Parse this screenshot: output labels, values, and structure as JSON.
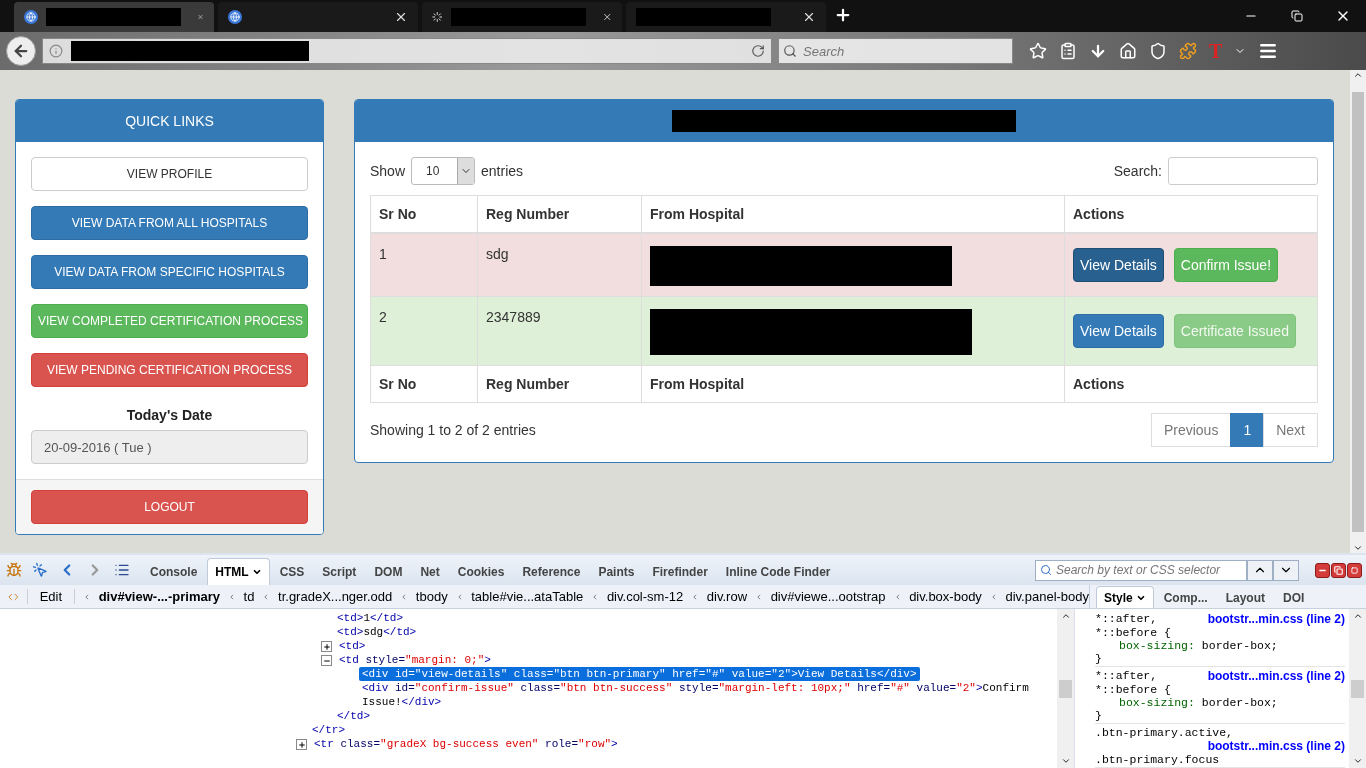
{
  "browser": {
    "tabs": [
      {
        "kind": "page",
        "selected": true
      },
      {
        "kind": "page",
        "selected": false
      },
      {
        "kind": "loading",
        "selected": false
      },
      {
        "kind": "blank",
        "selected": false
      }
    ],
    "search": {
      "placeholder": "Search"
    },
    "extension_label": "T"
  },
  "sidebar": {
    "title": "QUICK LINKS",
    "links": [
      {
        "label": "VIEW PROFILE",
        "kind": "default"
      },
      {
        "label": "VIEW DATA FROM ALL HOSPITALS",
        "kind": "primary"
      },
      {
        "label": "VIEW DATA FROM SPECIFIC HOSPITALS",
        "kind": "primary"
      },
      {
        "label": "VIEW COMPLETED CERTIFICATION PROCESS",
        "kind": "success"
      },
      {
        "label": "VIEW PENDING CERTIFICATION PROCESS",
        "kind": "danger"
      }
    ],
    "date_label": "Today's Date",
    "date_value": "20-09-2016 ( Tue )",
    "logout": "LOGOUT"
  },
  "panel": {
    "length": {
      "before": "Show",
      "value": "10",
      "after": "entries"
    },
    "search_label": "Search:",
    "table": {
      "columns": [
        "Sr No",
        "Reg Number",
        "From Hospital",
        "Actions"
      ],
      "rows": [
        {
          "color": "#f2dede",
          "sr_no": "1",
          "reg_number": "sdg",
          "actions": [
            {
              "label": "View Details",
              "kind": "primary",
              "active": true,
              "disabled": false
            },
            {
              "label": "Confirm Issue!",
              "kind": "success",
              "active": false,
              "disabled": false
            }
          ]
        },
        {
          "color": "#dff0d8",
          "sr_no": "2",
          "reg_number": "2347889",
          "actions": [
            {
              "label": "View Details",
              "kind": "primary",
              "active": false,
              "disabled": false
            },
            {
              "label": "Certificate Issued",
              "kind": "success",
              "active": false,
              "disabled": true
            }
          ]
        }
      ],
      "footer_columns": [
        "Sr No",
        "Reg Number",
        "From Hospital",
        "Actions"
      ]
    },
    "info": "Showing 1 to 2 of 2 entries",
    "pagination": [
      {
        "label": "Previous",
        "selected": false
      },
      {
        "label": "1",
        "selected": true
      },
      {
        "label": "Next",
        "selected": false
      }
    ]
  },
  "devtools": {
    "tabs": [
      {
        "label": "Console",
        "selected": false,
        "dropdown": false
      },
      {
        "label": "HTML",
        "selected": true,
        "dropdown": true
      },
      {
        "label": "CSS",
        "selected": false,
        "dropdown": false
      },
      {
        "label": "Script",
        "selected": false,
        "dropdown": false
      },
      {
        "label": "DOM",
        "selected": false,
        "dropdown": false
      },
      {
        "label": "Net",
        "selected": false,
        "dropdown": false
      },
      {
        "label": "Cookies",
        "selected": false,
        "dropdown": false
      },
      {
        "label": "Reference",
        "selected": false,
        "dropdown": false
      },
      {
        "label": "Paints",
        "selected": false,
        "dropdown": false
      },
      {
        "label": "Firefinder",
        "selected": false,
        "dropdown": false
      },
      {
        "label": "Inline Code Finder",
        "selected": false,
        "dropdown": false
      }
    ],
    "search": {
      "placeholder": "Search by text or CSS selector"
    },
    "edit": "Edit",
    "breadcrumbs": [
      {
        "label": "div#view-...-primary",
        "selected": true
      },
      {
        "label": "td",
        "selected": false
      },
      {
        "label": "tr.gradeX...nger.odd",
        "selected": false
      },
      {
        "label": "tbody",
        "selected": false
      },
      {
        "label": "table#vie...ataTable",
        "selected": false
      },
      {
        "label": "div.col-sm-12",
        "selected": false
      },
      {
        "label": "div.row",
        "selected": false
      },
      {
        "label": "div#viewe...ootstrap",
        "selected": false
      },
      {
        "label": "div.box-body",
        "selected": false
      },
      {
        "label": "div.panel-body",
        "selected": false
      }
    ],
    "side_tabs": [
      {
        "label": "Style",
        "selected": true,
        "dropdown": true
      },
      {
        "label": "Comp...",
        "selected": false,
        "dropdown": false
      },
      {
        "label": "Layout",
        "selected": false,
        "dropdown": false
      },
      {
        "label": "DOI",
        "selected": false,
        "dropdown": false
      }
    ],
    "html_tree": [
      {
        "selected": false,
        "expanded": true,
        "close": [
          {
            "kind": "tag",
            "text": "</tr>"
          }
        ],
        "children": [
          {
            "selected": false,
            "open": [
              {
                "kind": "tag",
                "text": "<td>"
              },
              {
                "kind": "text",
                "text": "1"
              },
              {
                "kind": "tag",
                "text": "</td>"
              }
            ]
          },
          {
            "selected": false,
            "open": [
              {
                "kind": "tag",
                "text": "<td>"
              },
              {
                "kind": "text",
                "text": "sdg"
              },
              {
                "kind": "tag",
                "text": "</td>"
              }
            ]
          },
          {
            "selected": false,
            "expanded": false,
            "open": [
              {
                "kind": "tag",
                "text": "<td>"
              }
            ]
          },
          {
            "selected": false,
            "expanded": true,
            "open": [
              {
                "kind": "tag",
                "text": "<td"
              },
              {
                "kind": "attr",
                "text": " style="
              },
              {
                "kind": "value",
                "text": "\"margin: 0;\""
              },
              {
                "kind": "tag",
                "text": ">"
              }
            ],
            "close": [
              {
                "kind": "tag",
                "text": "</td>"
              }
            ],
            "children": [
              {
                "selected": true,
                "open": [
                  {
                    "kind": "tag",
                    "text": "<div"
                  },
                  {
                    "kind": "attr",
                    "text": " id="
                  },
                  {
                    "kind": "value",
                    "text": "\"view-details\""
                  },
                  {
                    "kind": "attr",
                    "text": " class="
                  },
                  {
                    "kind": "value",
                    "text": "\"btn btn-primary\""
                  },
                  {
                    "kind": "attr",
                    "text": " href="
                  },
                  {
                    "kind": "value",
                    "text": "\"#\""
                  },
                  {
                    "kind": "attr",
                    "text": " value="
                  },
                  {
                    "kind": "value",
                    "text": "\"2\""
                  },
                  {
                    "kind": "tag",
                    "text": ">"
                  },
                  {
                    "kind": "text",
                    "text": "View Details"
                  },
                  {
                    "kind": "tag",
                    "text": "</div>"
                  }
                ]
              },
              {
                "selected": false,
                "open": [
                  {
                    "kind": "tag",
                    "text": "<div"
                  },
                  {
                    "kind": "attr",
                    "text": " id="
                  },
                  {
                    "kind": "value",
                    "text": "\"confirm-issue\""
                  },
                  {
                    "kind": "attr",
                    "text": " class="
                  },
                  {
                    "kind": "value",
                    "text": "\"btn btn-success\""
                  },
                  {
                    "kind": "attr",
                    "text": " style="
                  },
                  {
                    "kind": "value",
                    "text": "\"margin-left: 10px;\""
                  },
                  {
                    "kind": "attr",
                    "text": " href="
                  },
                  {
                    "kind": "value",
                    "text": "\"#\""
                  },
                  {
                    "kind": "attr",
                    "text": " value="
                  },
                  {
                    "kind": "value",
                    "text": "\"2\""
                  },
                  {
                    "kind": "tag",
                    "text": ">"
                  },
                  {
                    "kind": "text",
                    "text": "Confirm Issue!"
                  },
                  {
                    "kind": "tag",
                    "text": "</div>"
                  }
                ]
              }
            ]
          }
        ]
      },
      {
        "selected": false,
        "expanded": false,
        "open": [
          {
            "kind": "tag",
            "text": "<tr"
          },
          {
            "kind": "attr",
            "text": " class="
          },
          {
            "kind": "value",
            "text": "\"gradeX bg-success even\""
          },
          {
            "kind": "attr",
            "text": " role="
          },
          {
            "kind": "value",
            "text": "\"row\""
          },
          {
            "kind": "tag",
            "text": ">"
          }
        ]
      }
    ],
    "style_rules": [
      {
        "selectors": [
          "*::after,",
          "*::before {"
        ],
        "source": "bootstr...min.css (line 2)",
        "properties": [
          {
            "name": "box-sizing:",
            "value": "border-box;"
          }
        ],
        "close": "}"
      },
      {
        "selectors": [
          "*::after,",
          "*::before {"
        ],
        "source": "bootstr...min.css (line 2)",
        "properties": [
          {
            "name": "box-sizing:",
            "value": "border-box;"
          }
        ],
        "close": "}"
      },
      {
        "selectors": [
          ".btn-primary.active,",
          ".btn-primary.focus"
        ],
        "source": "bootstr...min.css (line 2)"
      }
    ]
  }
}
